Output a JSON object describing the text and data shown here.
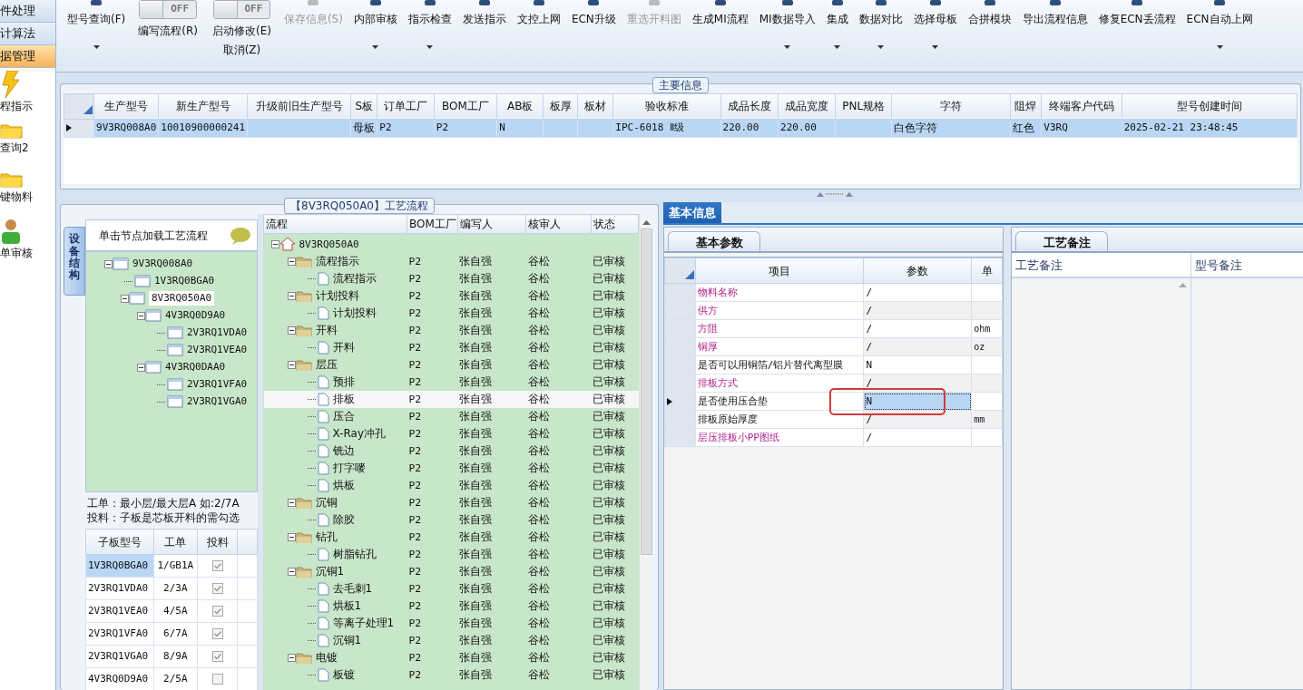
{
  "nav": {
    "groups": [
      {
        "label": "件处理",
        "selected": false
      },
      {
        "label": "计算法",
        "selected": false
      },
      {
        "label": "据管理",
        "selected": true
      }
    ],
    "items": [
      {
        "label": "程指示",
        "kind": "lightning"
      },
      {
        "label": "查询2",
        "kind": "folder"
      },
      {
        "label": "键物料",
        "kind": "folder"
      },
      {
        "label": "单审核",
        "kind": "person"
      }
    ]
  },
  "toolbar": [
    {
      "kind": "button",
      "label": "型号查询(F)",
      "disabled": false,
      "menu": true
    },
    {
      "kind": "toggle",
      "label": "编写流程(R)",
      "state_text": "OFF",
      "on": false
    },
    {
      "kind": "toggle",
      "label": "启动修改(E)",
      "sublabel": "取消(Z)",
      "state_text": "OFF",
      "on": false
    },
    {
      "kind": "button",
      "label": "保存信息(S)",
      "disabled": true,
      "menu": false
    },
    {
      "kind": "button",
      "label": "内部审核",
      "disabled": false,
      "menu": true
    },
    {
      "kind": "button",
      "label": "指示检查",
      "disabled": false,
      "menu": true
    },
    {
      "kind": "button",
      "label": "发送指示",
      "disabled": false,
      "menu": false
    },
    {
      "kind": "button",
      "label": "文控上网",
      "disabled": false,
      "menu": false
    },
    {
      "kind": "button",
      "label": "ECN升级",
      "disabled": false,
      "menu": false
    },
    {
      "kind": "button",
      "label": "重选开料图",
      "disabled": true,
      "menu": false
    },
    {
      "kind": "button",
      "label": "生成MI流程",
      "disabled": false,
      "menu": false
    },
    {
      "kind": "button",
      "label": "MI数据导入",
      "disabled": false,
      "menu": true
    },
    {
      "kind": "button",
      "label": "集成",
      "disabled": false,
      "menu": true
    },
    {
      "kind": "button",
      "label": "数据对比",
      "disabled": false,
      "menu": true
    },
    {
      "kind": "button",
      "label": "选择母板",
      "disabled": false,
      "menu": true
    },
    {
      "kind": "button",
      "label": "合拼模块",
      "disabled": false,
      "menu": false
    },
    {
      "kind": "button",
      "label": "导出流程信息",
      "disabled": false,
      "menu": false
    },
    {
      "kind": "button",
      "label": "修复ECN丢流程",
      "disabled": false,
      "menu": false
    },
    {
      "kind": "button",
      "label": "ECN自动上网",
      "disabled": false,
      "menu": true
    }
  ],
  "main_info": {
    "legend": "主要信息",
    "columns": [
      "生产型号",
      "新生产型号",
      "升级前旧生产型号",
      "S板",
      "订单工厂",
      "BOM工厂",
      "AB板",
      "板厚",
      "板材",
      "验收标准",
      "成品长度",
      "成品宽度",
      "PNL规格",
      "字符",
      "阻焊",
      "终端客户代码",
      "型号创建时间"
    ],
    "rows": [
      {
        "selected": true,
        "cells": [
          "9V3RQ008A0",
          "10010900000241",
          null,
          "母板",
          "P2",
          "P2",
          "N",
          null,
          null,
          "IPC-6018 Ⅱ级",
          "220.00",
          "220.00",
          null,
          "白色字符",
          "红色",
          "V3RQ",
          "2025-02-21 23:48:45"
        ]
      }
    ]
  },
  "process": {
    "legend": "【8V3RQ050A0】工艺流程",
    "side_tab": "设备结构",
    "tree_header": "单击节点加载工艺流程",
    "structure": [
      {
        "label": "9V3RQ008A0",
        "selected": false,
        "children": [
          {
            "label": "1V3RQ0BGA0",
            "selected": false
          },
          {
            "label": "8V3RQ050A0",
            "selected": true,
            "children": [
              {
                "label": "4V3RQ0D9A0",
                "selected": false,
                "children": [
                  {
                    "label": "2V3RQ1VDA0",
                    "selected": false
                  },
                  {
                    "label": "2V3RQ1VEA0",
                    "selected": false
                  }
                ]
              },
              {
                "label": "4V3RQ0DAA0",
                "selected": false,
                "children": [
                  {
                    "label": "2V3RQ1VFA0",
                    "selected": false
                  },
                  {
                    "label": "2V3RQ1VGA0",
                    "selected": false
                  }
                ]
              }
            ]
          }
        ]
      }
    ],
    "notes": [
      "工单：最小层/最大层A 如:2/7A",
      "投料：子板是芯板开料的需勾选"
    ],
    "subboards": {
      "columns": [
        "子板型号",
        "工单",
        "投料"
      ],
      "rows": [
        {
          "model": "1V3RQ0BGA0",
          "order": "1/GB1A",
          "checked": true,
          "selected": true
        },
        {
          "model": "2V3RQ1VDA0",
          "order": "2/3A",
          "checked": true,
          "selected": false
        },
        {
          "model": "2V3RQ1VEA0",
          "order": "4/5A",
          "checked": true,
          "selected": false
        },
        {
          "model": "2V3RQ1VFA0",
          "order": "6/7A",
          "checked": true,
          "selected": false
        },
        {
          "model": "2V3RQ1VGA0",
          "order": "8/9A",
          "checked": true,
          "selected": false
        },
        {
          "model": "4V3RQ0D9A0",
          "order": "2/5A",
          "checked": false,
          "selected": false
        }
      ]
    },
    "flow": {
      "columns": [
        "流程",
        "BOM工厂",
        "编写人",
        "核审人",
        "状态"
      ],
      "tree": [
        {
          "kind": "root",
          "label": "8V3RQ050A0",
          "selected": false,
          "children": [
            {
              "kind": "folder",
              "label": "流程指示",
              "bom": "P2",
              "writer": "张自强",
              "reviewer": "谷松",
              "status": "已审核",
              "selected": false,
              "children": [
                {
                  "kind": "step",
                  "label": "流程指示",
                  "bom": "P2",
                  "writer": "张自强",
                  "reviewer": "谷松",
                  "status": "已审核",
                  "selected": false
                }
              ]
            },
            {
              "kind": "folder",
              "label": "计划投料",
              "bom": "P2",
              "writer": "张自强",
              "reviewer": "谷松",
              "status": "已审核",
              "selected": false,
              "children": [
                {
                  "kind": "step",
                  "label": "计划投料",
                  "bom": "P2",
                  "writer": "张自强",
                  "reviewer": "谷松",
                  "status": "已审核",
                  "selected": false
                }
              ]
            },
            {
              "kind": "folder",
              "label": "开料",
              "bom": "P2",
              "writer": "张自强",
              "reviewer": "谷松",
              "status": "已审核",
              "selected": false,
              "children": [
                {
                  "kind": "step",
                  "label": "开料",
                  "bom": "P2",
                  "writer": "张自强",
                  "reviewer": "谷松",
                  "status": "已审核",
                  "selected": false
                }
              ]
            },
            {
              "kind": "folder",
              "label": "层压",
              "bom": "P2",
              "writer": "张自强",
              "reviewer": "谷松",
              "status": "已审核",
              "selected": false,
              "children": [
                {
                  "kind": "step",
                  "label": "预排",
                  "bom": "P2",
                  "writer": "张自强",
                  "reviewer": "谷松",
                  "status": "已审核",
                  "selected": false
                },
                {
                  "kind": "step",
                  "label": "排板",
                  "bom": "P2",
                  "writer": "张自强",
                  "reviewer": "谷松",
                  "status": "已审核",
                  "selected": true
                },
                {
                  "kind": "step",
                  "label": "压合",
                  "bom": "P2",
                  "writer": "张自强",
                  "reviewer": "谷松",
                  "status": "已审核",
                  "selected": false
                },
                {
                  "kind": "step",
                  "label": "X-Ray冲孔",
                  "bom": "P2",
                  "writer": "张自强",
                  "reviewer": "谷松",
                  "status": "已审核",
                  "selected": false
                },
                {
                  "kind": "step",
                  "label": "铣边",
                  "bom": "P2",
                  "writer": "张自强",
                  "reviewer": "谷松",
                  "status": "已审核",
                  "selected": false
                },
                {
                  "kind": "step",
                  "label": "打字嘜",
                  "bom": "P2",
                  "writer": "张自强",
                  "reviewer": "谷松",
                  "status": "已审核",
                  "selected": false
                },
                {
                  "kind": "step",
                  "label": "烘板",
                  "bom": "P2",
                  "writer": "张自强",
                  "reviewer": "谷松",
                  "status": "已审核",
                  "selected": false
                }
              ]
            },
            {
              "kind": "folder",
              "label": "沉铜",
              "bom": "P2",
              "writer": "张自强",
              "reviewer": "谷松",
              "status": "已审核",
              "selected": false,
              "children": [
                {
                  "kind": "step",
                  "label": "除胶",
                  "bom": "P2",
                  "writer": "张自强",
                  "reviewer": "谷松",
                  "status": "已审核",
                  "selected": false
                }
              ]
            },
            {
              "kind": "folder",
              "label": "钻孔",
              "bom": "P2",
              "writer": "张自强",
              "reviewer": "谷松",
              "status": "已审核",
              "selected": false,
              "children": [
                {
                  "kind": "step",
                  "label": "树脂钻孔",
                  "bom": "P2",
                  "writer": "张自强",
                  "reviewer": "谷松",
                  "status": "已审核",
                  "selected": false
                }
              ]
            },
            {
              "kind": "folder",
              "label": "沉铜1",
              "bom": "P2",
              "writer": "张自强",
              "reviewer": "谷松",
              "status": "已审核",
              "selected": false,
              "children": [
                {
                  "kind": "step",
                  "label": "去毛刺1",
                  "bom": "P2",
                  "writer": "张自强",
                  "reviewer": "谷松",
                  "status": "已审核",
                  "selected": false
                },
                {
                  "kind": "step",
                  "label": "烘板1",
                  "bom": "P2",
                  "writer": "张自强",
                  "reviewer": "谷松",
                  "status": "已审核",
                  "selected": false
                },
                {
                  "kind": "step",
                  "label": "等离子处理1",
                  "bom": "P2",
                  "writer": "张自强",
                  "reviewer": "谷松",
                  "status": "已审核",
                  "selected": false
                },
                {
                  "kind": "step",
                  "label": "沉铜1",
                  "bom": "P2",
                  "writer": "张自强",
                  "reviewer": "谷松",
                  "status": "已审核",
                  "selected": false
                }
              ]
            },
            {
              "kind": "folder",
              "label": "电镀",
              "bom": "P2",
              "writer": "张自强",
              "reviewer": "谷松",
              "status": "已审核",
              "selected": false,
              "children": [
                {
                  "kind": "step",
                  "label": "板镀",
                  "bom": "P2",
                  "writer": "张自强",
                  "reviewer": "谷松",
                  "status": "已审核",
                  "selected": false
                }
              ]
            }
          ]
        }
      ]
    }
  },
  "detail": {
    "tabs": [
      {
        "label": "基本信息",
        "selected": true
      }
    ],
    "params": {
      "tab": "基本参数",
      "columns": [
        "项目",
        "参数",
        "单"
      ],
      "rows": [
        {
          "item": "物料名称",
          "value": "/",
          "emphasis": true,
          "selected": false,
          "annotated": false
        },
        {
          "item": "供方",
          "value": "/",
          "emphasis": true,
          "selected": false,
          "annotated": false
        },
        {
          "item": "方阻",
          "value": "/",
          "unit": "ohm",
          "emphasis": true,
          "selected": false,
          "annotated": false
        },
        {
          "item": "铜厚",
          "value": "/",
          "unit": "oz",
          "emphasis": true,
          "selected": false,
          "annotated": false
        },
        {
          "item": "是否可以用铜箔/铝片替代离型膜",
          "value": "N",
          "emphasis": false,
          "selected": false,
          "annotated": false
        },
        {
          "item": "排板方式",
          "value": "/",
          "emphasis": true,
          "selected": false,
          "annotated": false
        },
        {
          "item": "是否使用压合垫",
          "value": "N",
          "emphasis": false,
          "selected": true,
          "annotated": true
        },
        {
          "item": "排板原始厚度",
          "value": "/",
          "unit": "mm",
          "emphasis": false,
          "selected": false,
          "annotated": false
        },
        {
          "item": "层压排板小PP图纸",
          "value": "/",
          "emphasis": true,
          "selected": false,
          "annotated": false
        }
      ]
    },
    "notes": {
      "tab": "工艺备注",
      "columns": [
        "工艺备注",
        "型号备注"
      ]
    }
  }
}
